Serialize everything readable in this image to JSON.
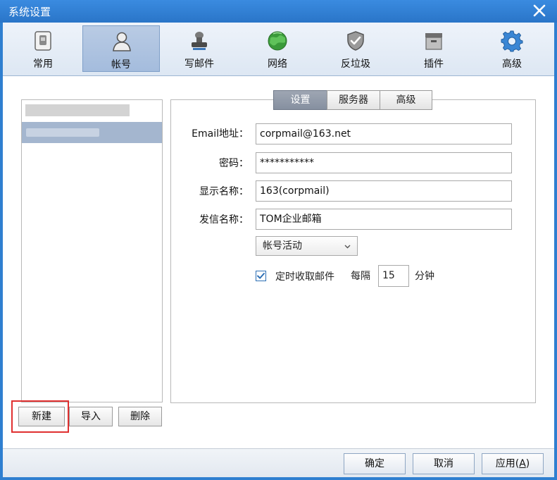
{
  "window": {
    "title": "系统设置"
  },
  "toolbar": {
    "items": [
      {
        "label": "常用",
        "icon": "phone-icon"
      },
      {
        "label": "帐号",
        "icon": "user-icon"
      },
      {
        "label": "写邮件",
        "icon": "stamp-icon"
      },
      {
        "label": "网络",
        "icon": "globe-icon"
      },
      {
        "label": "反垃圾",
        "icon": "shield-icon"
      },
      {
        "label": "插件",
        "icon": "box-icon"
      },
      {
        "label": "高级",
        "icon": "gear-icon"
      }
    ],
    "active": "帐号"
  },
  "account_panel": {
    "buttons": {
      "new": "新建",
      "import": "导入",
      "delete": "删除"
    }
  },
  "tabs": [
    {
      "label": "设置",
      "active": true
    },
    {
      "label": "服务器",
      "active": false
    },
    {
      "label": "高级",
      "active": false
    }
  ],
  "form": {
    "email_label": "Email地址：",
    "email_value": "corpmail@163.net",
    "password_label": "密码：",
    "password_value": "***********",
    "display_name_label": "显示名称：",
    "display_name_value": "163(corpmail)",
    "sender_name_label": "发信名称：",
    "sender_name_value": "TOM企业邮箱",
    "status_select": "帐号活动",
    "auto_fetch_label": "定时收取邮件",
    "auto_fetch_checked": true,
    "every_label": "每隔",
    "interval_value": "15",
    "interval_unit": "分钟"
  },
  "footer": {
    "ok": "确定",
    "cancel": "取消",
    "apply_prefix": "应用(",
    "apply_key": "A",
    "apply_suffix": ")"
  },
  "colors": {
    "titlebar": "#2f7fd0",
    "active_tab": "#8f99a8",
    "highlight": "#e03030"
  }
}
